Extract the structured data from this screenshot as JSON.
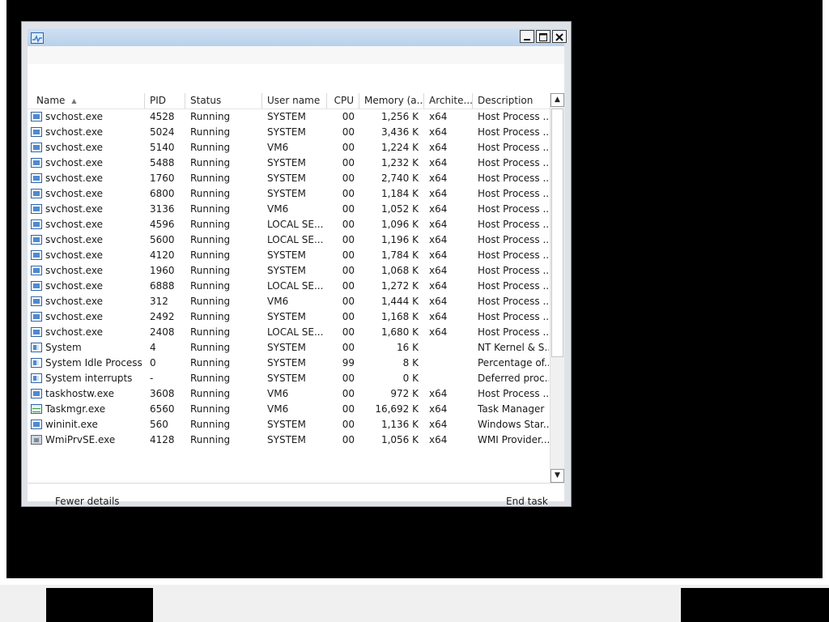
{
  "columns": [
    {
      "key": "name",
      "label": "Name"
    },
    {
      "key": "pid",
      "label": "PID"
    },
    {
      "key": "status",
      "label": "Status"
    },
    {
      "key": "user",
      "label": "User name"
    },
    {
      "key": "cpu",
      "label": "CPU"
    },
    {
      "key": "memory",
      "label": "Memory (a..."
    },
    {
      "key": "arch",
      "label": "Archite..."
    },
    {
      "key": "desc",
      "label": "Description"
    }
  ],
  "sort": {
    "column": "Name",
    "direction": "ascending"
  },
  "rows": [
    {
      "icon": "process-icon",
      "name": "svchost.exe",
      "pid": "4528",
      "status": "Running",
      "user": "SYSTEM",
      "cpu": "00",
      "memory": "1,256 K",
      "arch": "x64",
      "desc": "Host Process ..."
    },
    {
      "icon": "process-icon",
      "name": "svchost.exe",
      "pid": "5024",
      "status": "Running",
      "user": "SYSTEM",
      "cpu": "00",
      "memory": "3,436 K",
      "arch": "x64",
      "desc": "Host Process ..."
    },
    {
      "icon": "process-icon",
      "name": "svchost.exe",
      "pid": "5140",
      "status": "Running",
      "user": "VM6",
      "cpu": "00",
      "memory": "1,224 K",
      "arch": "x64",
      "desc": "Host Process ..."
    },
    {
      "icon": "process-icon",
      "name": "svchost.exe",
      "pid": "5488",
      "status": "Running",
      "user": "SYSTEM",
      "cpu": "00",
      "memory": "1,232 K",
      "arch": "x64",
      "desc": "Host Process ..."
    },
    {
      "icon": "process-icon",
      "name": "svchost.exe",
      "pid": "1760",
      "status": "Running",
      "user": "SYSTEM",
      "cpu": "00",
      "memory": "2,740 K",
      "arch": "x64",
      "desc": "Host Process ..."
    },
    {
      "icon": "process-icon",
      "name": "svchost.exe",
      "pid": "6800",
      "status": "Running",
      "user": "SYSTEM",
      "cpu": "00",
      "memory": "1,184 K",
      "arch": "x64",
      "desc": "Host Process ..."
    },
    {
      "icon": "process-icon",
      "name": "svchost.exe",
      "pid": "3136",
      "status": "Running",
      "user": "VM6",
      "cpu": "00",
      "memory": "1,052 K",
      "arch": "x64",
      "desc": "Host Process ..."
    },
    {
      "icon": "process-icon",
      "name": "svchost.exe",
      "pid": "4596",
      "status": "Running",
      "user": "LOCAL SE...",
      "cpu": "00",
      "memory": "1,096 K",
      "arch": "x64",
      "desc": "Host Process ..."
    },
    {
      "icon": "process-icon",
      "name": "svchost.exe",
      "pid": "5600",
      "status": "Running",
      "user": "LOCAL SE...",
      "cpu": "00",
      "memory": "1,196 K",
      "arch": "x64",
      "desc": "Host Process ..."
    },
    {
      "icon": "process-icon",
      "name": "svchost.exe",
      "pid": "4120",
      "status": "Running",
      "user": "SYSTEM",
      "cpu": "00",
      "memory": "1,784 K",
      "arch": "x64",
      "desc": "Host Process ..."
    },
    {
      "icon": "process-icon",
      "name": "svchost.exe",
      "pid": "1960",
      "status": "Running",
      "user": "SYSTEM",
      "cpu": "00",
      "memory": "1,068 K",
      "arch": "x64",
      "desc": "Host Process ..."
    },
    {
      "icon": "process-icon",
      "name": "svchost.exe",
      "pid": "6888",
      "status": "Running",
      "user": "LOCAL SE...",
      "cpu": "00",
      "memory": "1,272 K",
      "arch": "x64",
      "desc": "Host Process ..."
    },
    {
      "icon": "process-icon",
      "name": "svchost.exe",
      "pid": "312",
      "status": "Running",
      "user": "VM6",
      "cpu": "00",
      "memory": "1,444 K",
      "arch": "x64",
      "desc": "Host Process ..."
    },
    {
      "icon": "process-icon",
      "name": "svchost.exe",
      "pid": "2492",
      "status": "Running",
      "user": "SYSTEM",
      "cpu": "00",
      "memory": "1,168 K",
      "arch": "x64",
      "desc": "Host Process ..."
    },
    {
      "icon": "process-icon",
      "name": "svchost.exe",
      "pid": "2408",
      "status": "Running",
      "user": "LOCAL SE...",
      "cpu": "00",
      "memory": "1,680 K",
      "arch": "x64",
      "desc": "Host Process ..."
    },
    {
      "icon": "system-process-icon",
      "name": "System",
      "pid": "4",
      "status": "Running",
      "user": "SYSTEM",
      "cpu": "00",
      "memory": "16 K",
      "arch": "",
      "desc": "NT Kernel & S..."
    },
    {
      "icon": "system-process-icon",
      "name": "System Idle Process",
      "pid": "0",
      "status": "Running",
      "user": "SYSTEM",
      "cpu": "99",
      "memory": "8 K",
      "arch": "",
      "desc": "Percentage of..."
    },
    {
      "icon": "system-process-icon",
      "name": "System interrupts",
      "pid": "-",
      "status": "Running",
      "user": "SYSTEM",
      "cpu": "00",
      "memory": "0 K",
      "arch": "",
      "desc": "Deferred proc..."
    },
    {
      "icon": "process-icon",
      "name": "taskhostw.exe",
      "pid": "3608",
      "status": "Running",
      "user": "VM6",
      "cpu": "00",
      "memory": "972 K",
      "arch": "x64",
      "desc": "Host Process ..."
    },
    {
      "icon": "task-manager-icon",
      "name": "Taskmgr.exe",
      "pid": "6560",
      "status": "Running",
      "user": "VM6",
      "cpu": "00",
      "memory": "16,692 K",
      "arch": "x64",
      "desc": "Task Manager"
    },
    {
      "icon": "process-icon",
      "name": "wininit.exe",
      "pid": "560",
      "status": "Running",
      "user": "SYSTEM",
      "cpu": "00",
      "memory": "1,136 K",
      "arch": "x64",
      "desc": "Windows Star..."
    },
    {
      "icon": "wmi-provider-icon",
      "name": "WmiPrvSE.exe",
      "pid": "4128",
      "status": "Running",
      "user": "SYSTEM",
      "cpu": "00",
      "memory": "1,056 K",
      "arch": "x64",
      "desc": "WMI Provider..."
    }
  ],
  "footer": {
    "fewer_details": "Fewer details",
    "end_task": "End task"
  },
  "titlebar": {
    "app_icon": "task-manager-icon",
    "buttons": [
      "minimize-icon",
      "maximize-icon",
      "close-icon"
    ]
  },
  "colors": {
    "titlebar_top": "#cfe0f2",
    "titlebar_bottom": "#b9d1ec",
    "desktop": "#000000",
    "icon_blue": "#2e63a8"
  }
}
